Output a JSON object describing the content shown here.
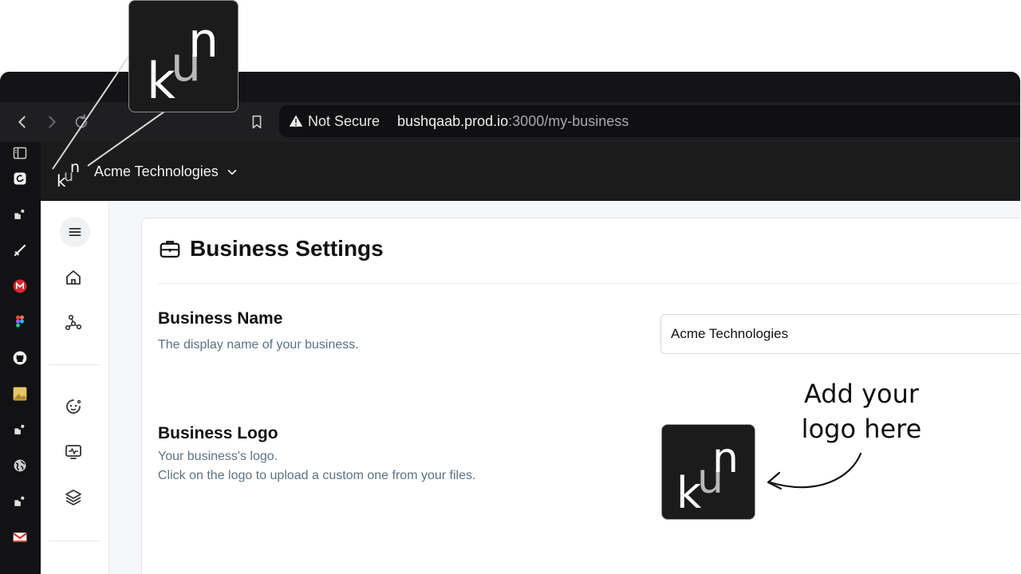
{
  "browser": {
    "address": {
      "security_label": "Not Secure",
      "host": "bushqaab.prod.io",
      "path": ":3000/my-business"
    }
  },
  "app": {
    "business_switcher": {
      "label": "Acme Technologies"
    },
    "logo_letters": "kun"
  },
  "page": {
    "title": "Business Settings",
    "fields": {
      "name": {
        "label": "Business Name",
        "description": "The display name of your business.",
        "value": "Acme Technologies"
      },
      "logo": {
        "label": "Business Logo",
        "description_line1": "Your business's logo.",
        "description_line2": "Click on the logo to upload a custom one from your files."
      }
    }
  },
  "annotation": {
    "line1": "Add your",
    "line2": "logo here"
  },
  "colors": {
    "window_bg": "#1f1f22",
    "app_header_bg": "#1b1b1b",
    "muted_text": "#5b7286",
    "logo_bg": "#1b1b1b",
    "logo_accent": "#b8b8b8"
  },
  "icons": {
    "sidebar": [
      "home-icon",
      "network-icon",
      "face-icon",
      "monitor-icon",
      "layers-icon"
    ],
    "browser_sidebar": [
      "sidebar-toggle-icon",
      "note-icon",
      "puzzle-icon",
      "sword-icon",
      "mega-icon",
      "figma-icon",
      "github-icon",
      "image-icon",
      "puzzle-icon",
      "globe-icon",
      "puzzle-icon",
      "gmail-icon"
    ]
  }
}
